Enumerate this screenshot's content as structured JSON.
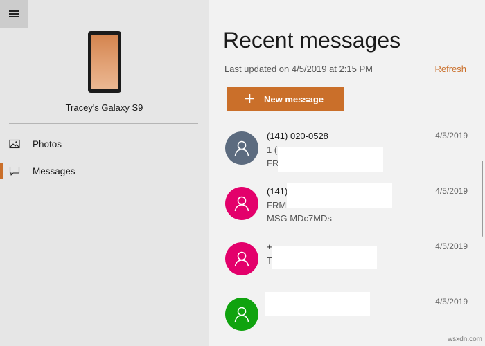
{
  "sidebar": {
    "device_name": "Tracey's Galaxy S9",
    "nav": [
      {
        "label": "Photos",
        "icon": "photos-icon",
        "selected": false
      },
      {
        "label": "Messages",
        "icon": "messages-icon",
        "selected": true
      }
    ]
  },
  "main": {
    "title": "Recent messages",
    "last_updated": "Last updated on 4/5/2019 at 2:15 PM",
    "refresh_label": "Refresh",
    "new_message_label": "New message",
    "conversations": [
      {
        "name": "(141) 020-0528",
        "preview1": "1 (...",
        "preview2": "FR",
        "date": "4/5/2019",
        "avatar_color": "#5c6b7f"
      },
      {
        "name": "(141) 010-0008",
        "preview1": "FRM:",
        "preview2": "MSG                              MDc7MDs",
        "date": "4/5/2019",
        "avatar_color": "#e3006b"
      },
      {
        "name": "+",
        "preview1": "T",
        "preview2": "",
        "date": "4/5/2019",
        "avatar_color": "#e3006b"
      },
      {
        "name": "",
        "preview1": "",
        "preview2": "",
        "date": "4/5/2019",
        "avatar_color": "#10a30f"
      }
    ]
  },
  "watermark": "wsxdn.com",
  "colors": {
    "accent": "#ca6f2a",
    "sidebar_bg": "#e6e6e6",
    "main_bg": "#f2f2f2"
  }
}
